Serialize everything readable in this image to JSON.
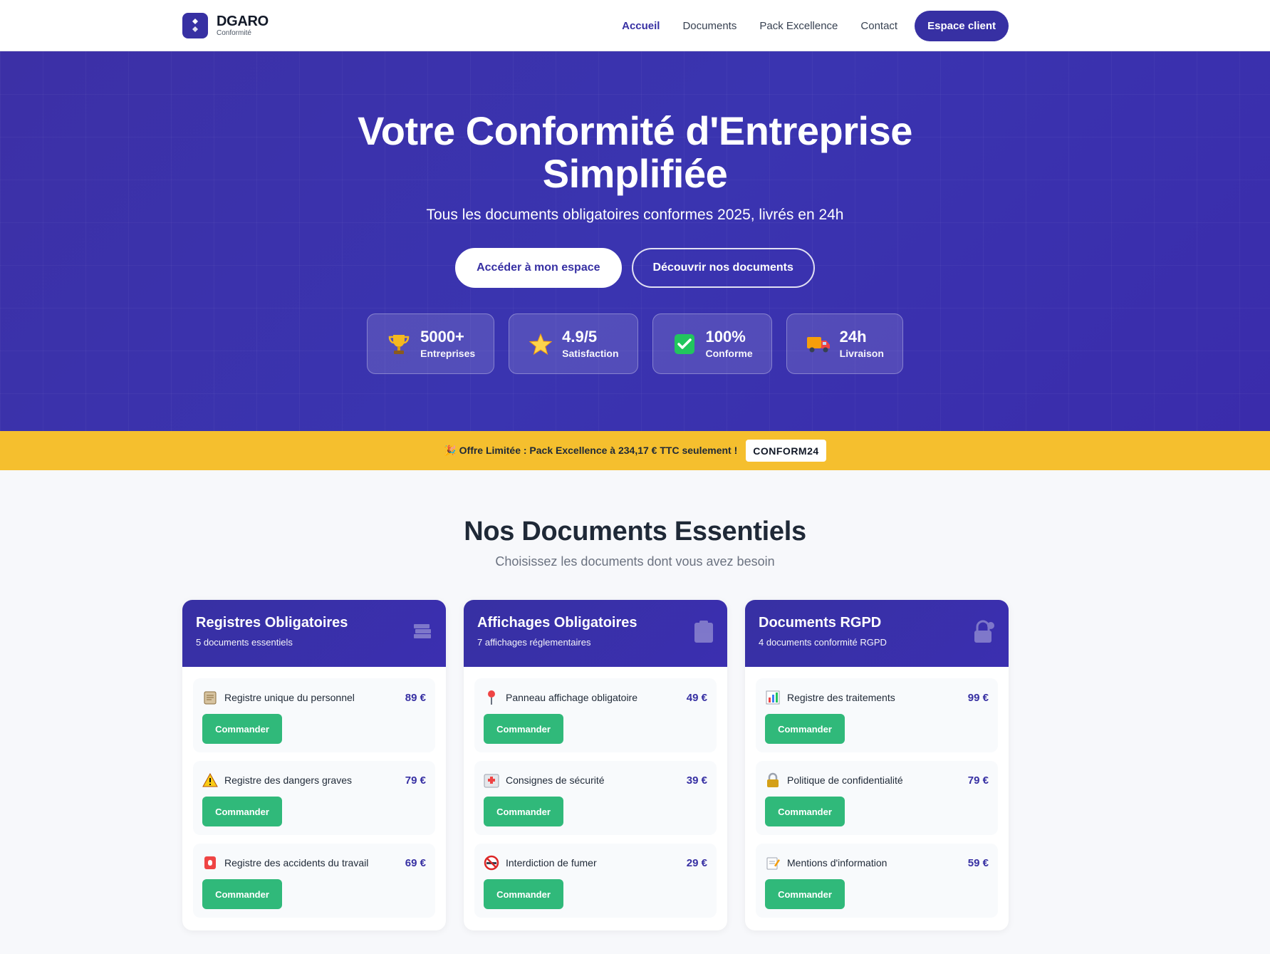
{
  "header": {
    "logo_name": "DGARO",
    "logo_sub": "Conformité",
    "nav": [
      {
        "label": "Accueil",
        "active": true
      },
      {
        "label": "Documents"
      },
      {
        "label": "Pack Excellence"
      },
      {
        "label": "Contact"
      }
    ],
    "cta": "Espace client"
  },
  "hero": {
    "title_line1": "Votre Conformité d'Entreprise",
    "title_line2": "Simplifiée",
    "subtitle": "Tous les documents obligatoires conformes 2025, livrés en 24h",
    "primary_button": "Accéder à mon espace",
    "secondary_button": "Découvrir nos documents",
    "stats": [
      {
        "icon": "trophy-icon",
        "value": "5000+",
        "label": "Entreprises"
      },
      {
        "icon": "star-icon",
        "value": "4.9/5",
        "label": "Satisfaction"
      },
      {
        "icon": "check-icon",
        "value": "100%",
        "label": "Conforme"
      },
      {
        "icon": "truck-icon",
        "value": "24h",
        "label": "Livraison"
      }
    ]
  },
  "promo": {
    "icon": "party-icon",
    "text": "Offre Limitée : Pack Excellence à 234,17 € TTC seulement !",
    "code": "CONFORM24"
  },
  "section": {
    "title": "Nos Documents Essentiels",
    "subtitle": "Choisissez les documents dont vous avez besoin"
  },
  "cards": [
    {
      "title": "Registres Obligatoires",
      "count": "5 documents essentiels",
      "icon": "books-icon",
      "items": [
        {
          "icon": "clipboard-icon",
          "name": "Registre unique du personnel",
          "price": "89 €",
          "button": "Commander"
        },
        {
          "icon": "warning-icon",
          "name": "Registre des dangers graves",
          "price": "79 €",
          "button": "Commander"
        },
        {
          "icon": "siren-icon",
          "name": "Registre des accidents du travail",
          "price": "69 €",
          "button": "Commander"
        }
      ]
    },
    {
      "title": "Affichages Obligatoires",
      "count": "7 affichages réglementaires",
      "icon": "clipboard-icon",
      "items": [
        {
          "icon": "pin-icon",
          "name": "Panneau affichage obligatoire",
          "price": "49 €",
          "button": "Commander"
        },
        {
          "icon": "hospital-icon",
          "name": "Consignes de sécurité",
          "price": "39 €",
          "button": "Commander"
        },
        {
          "icon": "no-smoking-icon",
          "name": "Interdiction de fumer",
          "price": "29 €",
          "button": "Commander"
        }
      ]
    },
    {
      "title": "Documents RGPD",
      "count": "4 documents conformité RGPD",
      "icon": "lock-icon",
      "items": [
        {
          "icon": "chart-icon",
          "name": "Registre des traitements",
          "price": "99 €",
          "button": "Commander"
        },
        {
          "icon": "lock-icon",
          "name": "Politique de confidentialité",
          "price": "79 €",
          "button": "Commander"
        },
        {
          "icon": "memo-icon",
          "name": "Mentions d'information",
          "price": "59 €",
          "button": "Commander"
        }
      ]
    }
  ]
}
